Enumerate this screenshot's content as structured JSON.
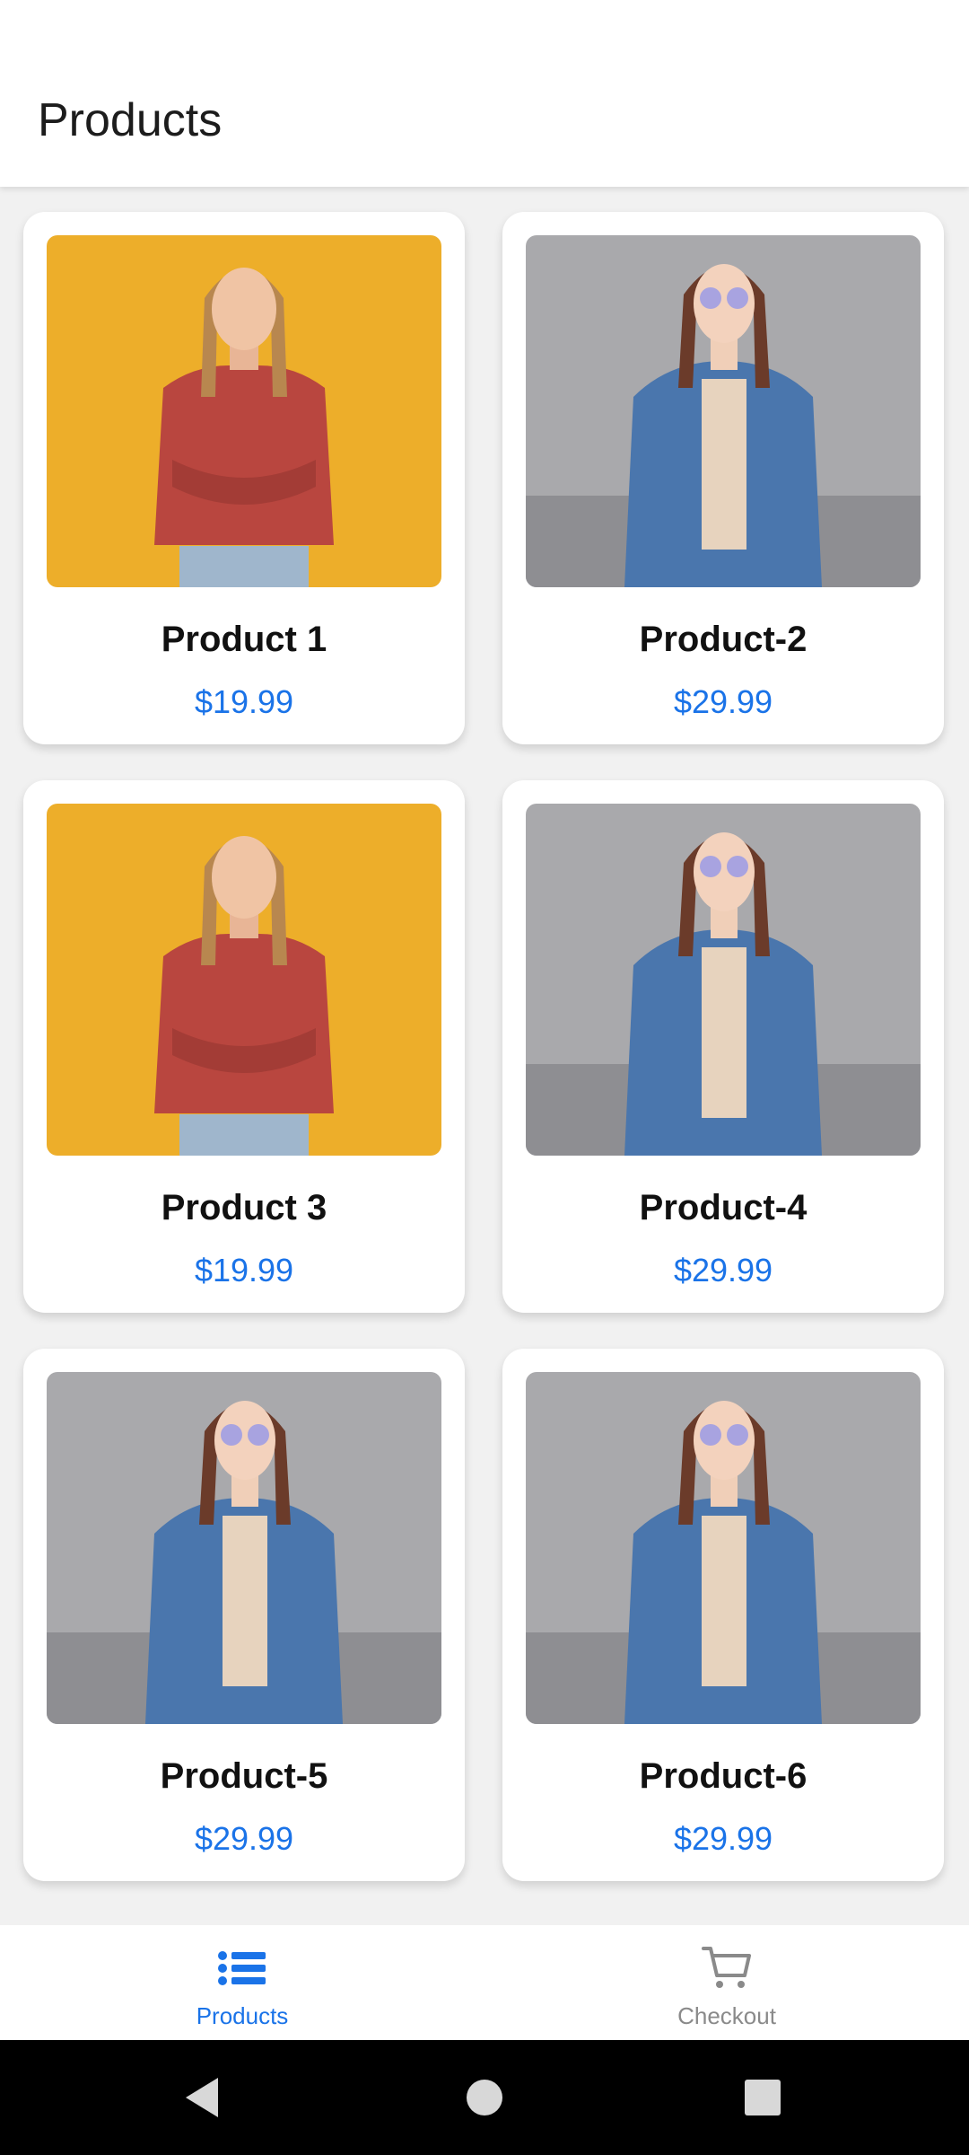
{
  "header": {
    "title": "Products"
  },
  "products": [
    {
      "name": "Product 1",
      "price": "$19.99",
      "image": "woman-red-sweater-photo"
    },
    {
      "name": "Product-2",
      "price": "$29.99",
      "image": "woman-denim-jacket-photo"
    },
    {
      "name": "Product 3",
      "price": "$19.99",
      "image": "woman-red-sweater-photo"
    },
    {
      "name": "Product-4",
      "price": "$29.99",
      "image": "woman-denim-jacket-photo"
    },
    {
      "name": "Product-5",
      "price": "$29.99",
      "image": "woman-denim-jacket-photo"
    },
    {
      "name": "Product-6",
      "price": "$29.99",
      "image": "woman-denim-jacket-photo"
    }
  ],
  "bottom_nav": {
    "tabs": [
      {
        "label": "Products",
        "icon": "list-icon",
        "active": true
      },
      {
        "label": "Checkout",
        "icon": "cart-icon",
        "active": false
      }
    ]
  },
  "system_nav": {
    "buttons": [
      "back-icon",
      "home-icon",
      "recents-icon"
    ]
  },
  "colors": {
    "accent": "#1a73e8",
    "inactive": "#8a8a8a",
    "background": "#f1f1f1",
    "card": "#ffffff",
    "yellow_backdrop": "#edae2a",
    "gray_backdrop": "#a9a9ac"
  }
}
